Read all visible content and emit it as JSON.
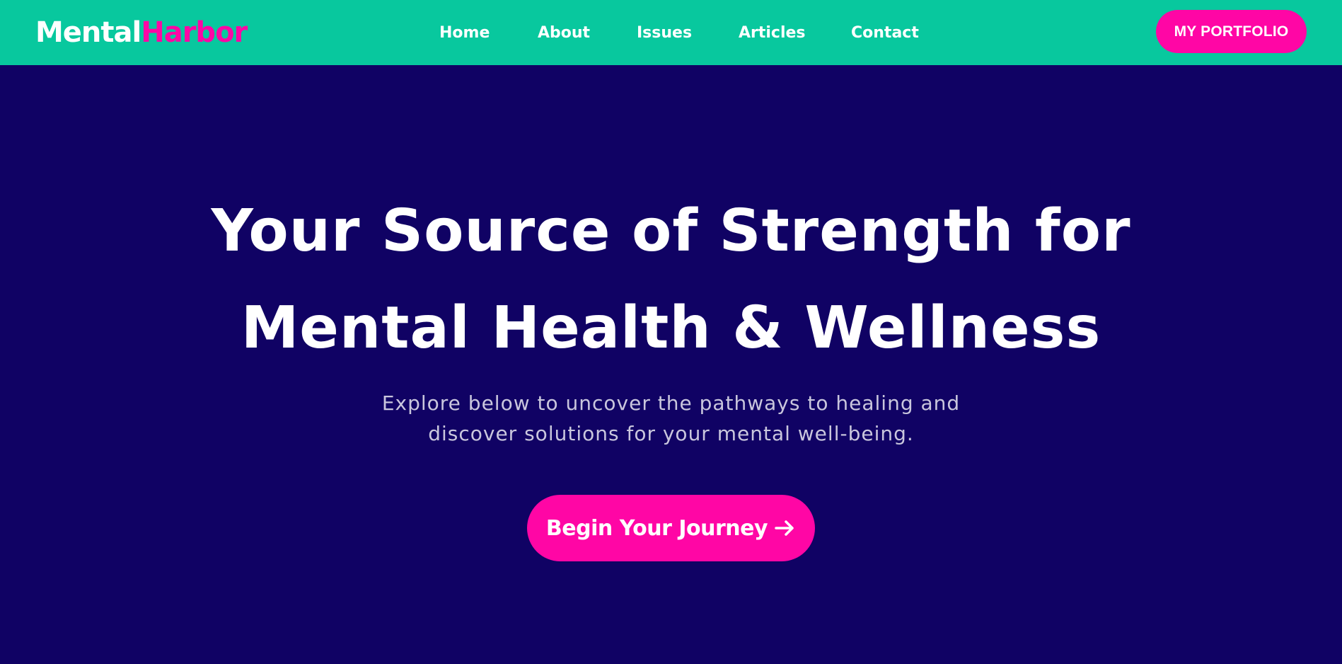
{
  "brand": {
    "name_part1": "Mental",
    "name_part2": "Harbor"
  },
  "nav": {
    "items": [
      {
        "label": "Home"
      },
      {
        "label": "About"
      },
      {
        "label": "Issues"
      },
      {
        "label": "Articles"
      },
      {
        "label": "Contact"
      }
    ],
    "portfolio_label": "MY PORTFOLIO"
  },
  "hero": {
    "title_line1": "Your Source of Strength for",
    "title_line2": "Mental Health & Wellness",
    "subtitle_line1": "Explore below to uncover the pathways to healing and",
    "subtitle_line2": "discover solutions for your mental well-being.",
    "cta_label": "Begin Your Journey",
    "cta_icon": "arrow-right-icon"
  },
  "colors": {
    "header_bg": "#08c89e",
    "page_bg": "#100264",
    "accent": "#ff06a5",
    "text_primary": "#ffffff",
    "text_muted": "#c9c6dd"
  }
}
